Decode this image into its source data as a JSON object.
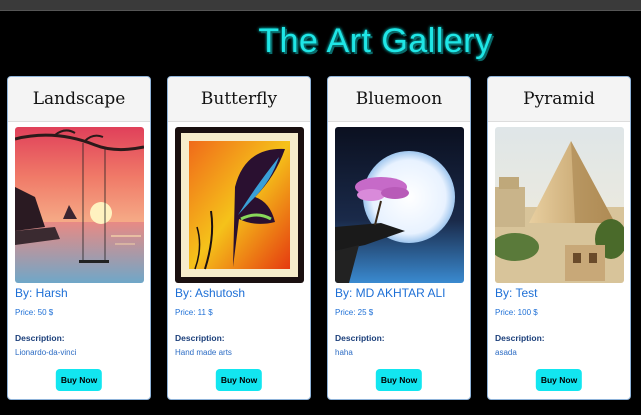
{
  "header": {
    "title": "The Art Gallery"
  },
  "cards": [
    {
      "title": "Landscape",
      "by": "By: Harsh",
      "price": "Price: 50 $",
      "description_label": "Description:",
      "description": "Lionardo-da-vinci",
      "button": "Buy Now"
    },
    {
      "title": "Butterfly",
      "by": "By: Ashutosh",
      "price": "Price: 11 $",
      "description_label": "Description:",
      "description": "Hand made arts",
      "button": "Buy Now"
    },
    {
      "title": "Bluemoon",
      "by": "By: MD AKHTAR ALI",
      "price": "Price: 25 $",
      "description_label": "Description:",
      "description": "haha",
      "button": "Buy Now"
    },
    {
      "title": "Pyramid",
      "by": "By: Test",
      "price": "Price: 100 $",
      "description_label": "Description:",
      "description": "asada",
      "button": "Buy Now"
    }
  ],
  "colors": {
    "background": "#000000",
    "title": "#1fe6e6",
    "button": "#12e6f0",
    "link_text": "#1d6fd6"
  }
}
